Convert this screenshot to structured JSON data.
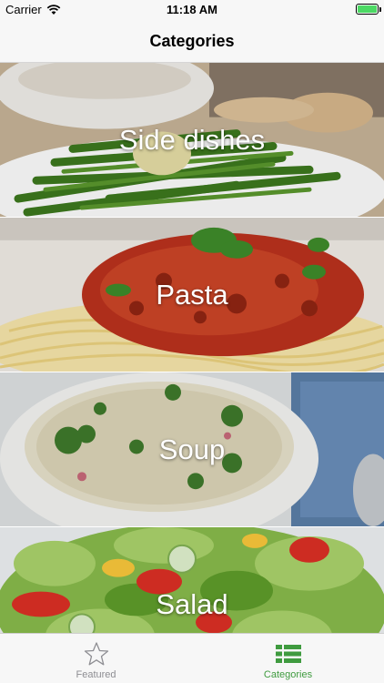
{
  "status_bar": {
    "carrier": "Carrier",
    "time": "11:18 AM",
    "battery_level": 1.0,
    "battery_color": "#4cd964"
  },
  "nav": {
    "title": "Categories"
  },
  "categories": [
    {
      "label": "Side dishes",
      "image": "green-beans-photo"
    },
    {
      "label": "Pasta",
      "image": "spaghetti-bolognese-photo"
    },
    {
      "label": "Soup",
      "image": "broccoli-soup-photo"
    },
    {
      "label": "Salad",
      "image": "green-salad-photo"
    }
  ],
  "tab_bar": {
    "tabs": [
      {
        "label": "Featured",
        "icon": "star-icon",
        "selected": false
      },
      {
        "label": "Categories",
        "icon": "list-icon",
        "selected": true
      }
    ],
    "selected_color": "#3f9b3f",
    "unselected_color": "#8e8e93"
  }
}
